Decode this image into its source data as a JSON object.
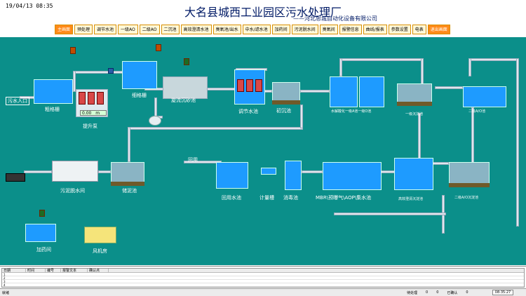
{
  "header": {
    "datetime": "19/04/13   08:35",
    "title": "大名县城西工业园区污水处理厂",
    "company": "——河北思城自动化设备有限公司"
  },
  "nav": {
    "items": [
      {
        "label": "主画面",
        "active": true
      },
      {
        "label": "预处理",
        "active": false
      },
      {
        "label": "调节水池",
        "active": false
      },
      {
        "label": "一级AO",
        "active": false
      },
      {
        "label": "二级AO",
        "active": false
      },
      {
        "label": "二沉池",
        "active": false
      },
      {
        "label": "高效澄清水池",
        "active": false
      },
      {
        "label": "臭氧池/出水",
        "active": false
      },
      {
        "label": "中水/滤水池",
        "active": false
      },
      {
        "label": "加药间",
        "active": false
      },
      {
        "label": "污泥脱水间",
        "active": false
      },
      {
        "label": "臭氧间",
        "active": false
      },
      {
        "label": "报警信息",
        "active": false
      },
      {
        "label": "曲线/报表",
        "active": false
      },
      {
        "label": "参数设置",
        "active": false
      },
      {
        "label": "电表",
        "active": false
      },
      {
        "label": "退出画面",
        "active": true
      }
    ]
  },
  "process": {
    "inlet": "污水入口",
    "coarse_screen": "粗格栅",
    "lift_pump": "提升泵",
    "level_value": "0.00",
    "level_unit": "m",
    "fine_screen": "细格栅",
    "grit_chamber": "旋流沉砂池",
    "regulating_tank": "调节水池",
    "primary_clarifier": "初沉池",
    "hydrolysis_a": "水解酸化一级A池",
    "aerobic_o": "一级O池",
    "first_sed": "一级沉淀池",
    "second_ao": "二级A/O池",
    "second_clarifier": "二级A/O沉淀池",
    "high_eff": "高效澄清沉淀池",
    "mbr": "MBR\\预曝气\\AOP\\集水池",
    "disinfect": "消毒池",
    "metering": "计量槽",
    "reuse_tank": "回用水池",
    "reuse": "回用",
    "sludge_storage": "储泥池",
    "dewatering": "污泥脱水间",
    "dosing": "加药间",
    "blower": "风机房"
  },
  "alarm": {
    "columns": [
      "日期",
      "时间",
      "编号",
      "报警文本",
      "确认点"
    ],
    "rows": [
      "1",
      "2",
      "3",
      "4"
    ]
  },
  "status": {
    "left": "就绪",
    "items": [
      "待处理",
      "0",
      "0",
      "已确认",
      "0"
    ],
    "clock": "08:35:27"
  }
}
